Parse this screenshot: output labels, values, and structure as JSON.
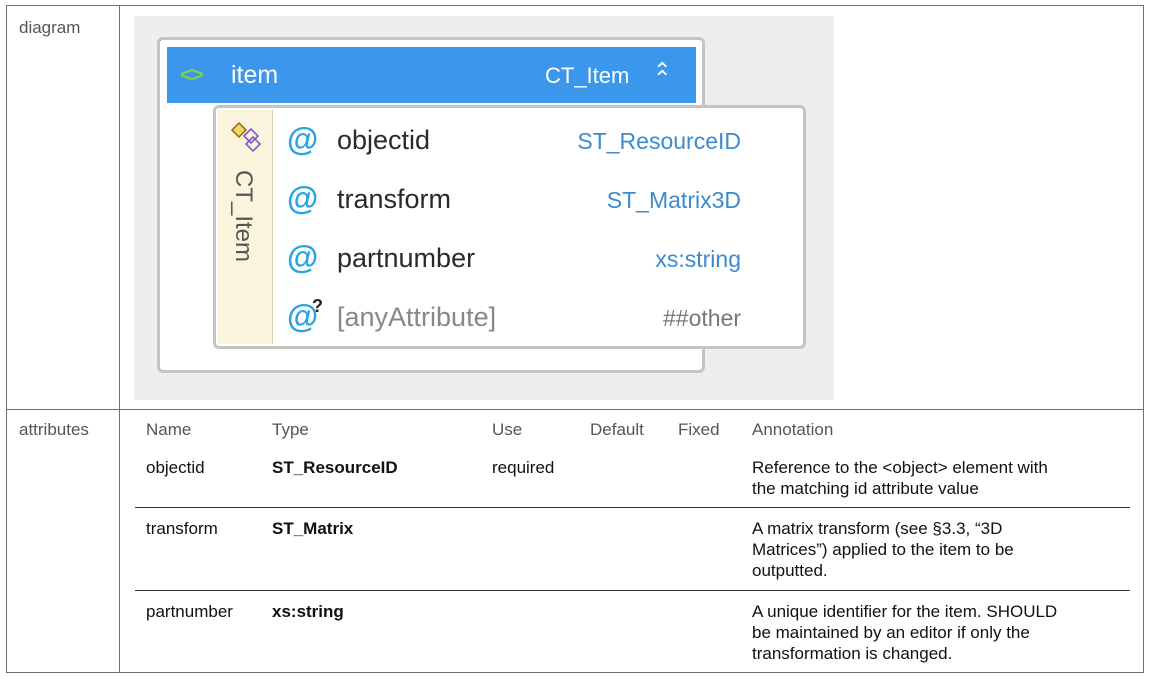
{
  "rows": {
    "diagram_label": "diagram",
    "attributes_label": "attributes"
  },
  "diagram": {
    "element_name": "item",
    "element_type": "CT_Item",
    "type_strip": "CT_Item",
    "attributes": [
      {
        "name": "objectid",
        "type": "ST_ResourceID"
      },
      {
        "name": "transform",
        "type": "ST_Matrix3D"
      },
      {
        "name": "partnumber",
        "type": "xs:string"
      },
      {
        "name": "[anyAttribute]",
        "type": "##other"
      }
    ],
    "colors": {
      "header": "#3a97ec",
      "at_symbol": "#2aa4e4",
      "type_text": "#3d8ad0"
    },
    "icons": [
      "code-icon",
      "collapse-icon",
      "complex-type-icon",
      "attribute-icon",
      "any-attribute-icon"
    ]
  },
  "table": {
    "headers": {
      "name": "Name",
      "type": "Type",
      "use": "Use",
      "default": "Default",
      "fixed": "Fixed",
      "annotation": "Annotation"
    },
    "rows": [
      {
        "name": "objectid",
        "type": "ST_ResourceID",
        "use": "required",
        "annotation": [
          "Reference to the <object> element with",
          "the matching id attribute value"
        ]
      },
      {
        "name": "transform",
        "type": "ST_Matrix",
        "use": "",
        "annotation": [
          "A matrix transform (see §3.3, “3D",
          "Matrices”) applied to the item to be",
          "outputted."
        ]
      },
      {
        "name": "partnumber",
        "type": "xs:string",
        "use": "",
        "annotation": [
          "A unique identifier for the item.  SHOULD",
          "be maintained by an editor if only the",
          "transformation is changed."
        ]
      }
    ]
  }
}
